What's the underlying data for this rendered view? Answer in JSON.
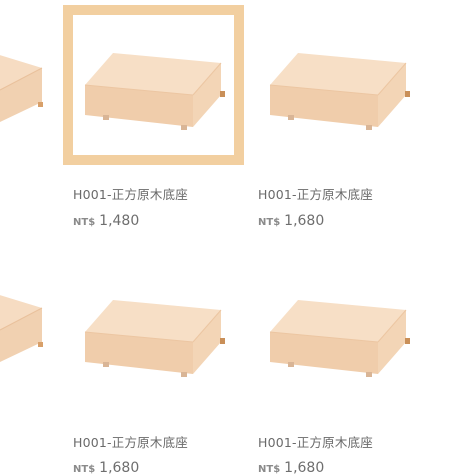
{
  "products": [
    {
      "name": "H001-正方原木底座",
      "currency": "NT$",
      "price": "1,480",
      "selected": true
    },
    {
      "name": "H001-正方原木底座",
      "currency": "NT$",
      "price": "1,680",
      "selected": false
    },
    {
      "name": "H001-正方原木底座",
      "currency": "NT$",
      "price": "1,680",
      "selected": false
    },
    {
      "name": "H001-正方原木底座",
      "currency": "NT$",
      "price": "1,680",
      "selected": false
    }
  ],
  "colors": {
    "selection_border": "#f2cfa0",
    "wood_top": "#f6dcc2",
    "wood_side": "#efcba9",
    "text": "#6a6a6a"
  },
  "icons": {
    "product_image": "square-wooden-base"
  }
}
